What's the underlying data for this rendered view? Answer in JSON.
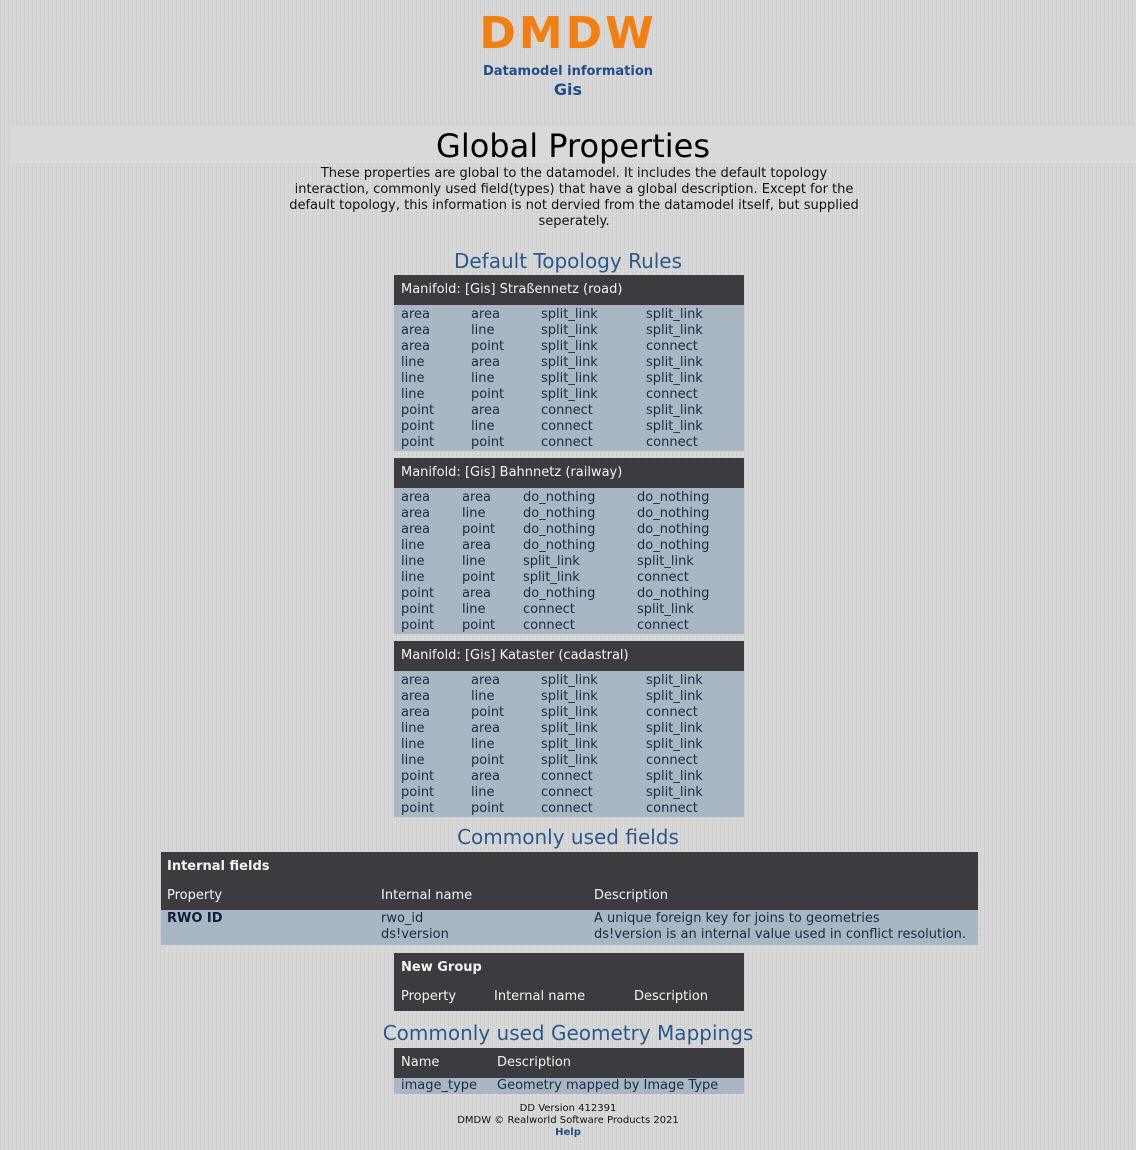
{
  "logo": "DMDW",
  "header": {
    "subtitle": "Datamodel information",
    "model": "Gis"
  },
  "page_title": "Global Properties",
  "intro": "These properties are global to the datamodel. It includes the default topology interaction, commonly used field(types) that have a global description. Except for the default topology, this information is not dervied from the datamodel itself, but supplied seperately.",
  "sections": {
    "topology": "Default Topology Rules",
    "fields": "Commonly used fields",
    "geometry": "Commonly used Geometry Mappings"
  },
  "manifolds": [
    {
      "title": "Manifold: [Gis] Straßennetz (road)",
      "rows": [
        [
          "area",
          "area",
          "split_link",
          "split_link"
        ],
        [
          "area",
          "line",
          "split_link",
          "split_link"
        ],
        [
          "area",
          "point",
          "split_link",
          "connect"
        ],
        [
          "line",
          "area",
          "split_link",
          "split_link"
        ],
        [
          "line",
          "line",
          "split_link",
          "split_link"
        ],
        [
          "line",
          "point",
          "split_link",
          "connect"
        ],
        [
          "point",
          "area",
          "connect",
          "split_link"
        ],
        [
          "point",
          "line",
          "connect",
          "split_link"
        ],
        [
          "point",
          "point",
          "connect",
          "connect"
        ]
      ]
    },
    {
      "title": "Manifold: [Gis] Bahnnetz (railway)",
      "rows": [
        [
          "area",
          "area",
          "do_nothing",
          "do_nothing"
        ],
        [
          "area",
          "line",
          "do_nothing",
          "do_nothing"
        ],
        [
          "area",
          "point",
          "do_nothing",
          "do_nothing"
        ],
        [
          "line",
          "area",
          "do_nothing",
          "do_nothing"
        ],
        [
          "line",
          "line",
          "split_link",
          "split_link"
        ],
        [
          "line",
          "point",
          "split_link",
          "connect"
        ],
        [
          "point",
          "area",
          "do_nothing",
          "do_nothing"
        ],
        [
          "point",
          "line",
          "connect",
          "split_link"
        ],
        [
          "point",
          "point",
          "connect",
          "connect"
        ]
      ]
    },
    {
      "title": "Manifold: [Gis] Kataster (cadastral)",
      "rows": [
        [
          "area",
          "area",
          "split_link",
          "split_link"
        ],
        [
          "area",
          "line",
          "split_link",
          "split_link"
        ],
        [
          "area",
          "point",
          "split_link",
          "connect"
        ],
        [
          "line",
          "area",
          "split_link",
          "split_link"
        ],
        [
          "line",
          "line",
          "split_link",
          "split_link"
        ],
        [
          "line",
          "point",
          "split_link",
          "connect"
        ],
        [
          "point",
          "area",
          "connect",
          "split_link"
        ],
        [
          "point",
          "line",
          "connect",
          "split_link"
        ],
        [
          "point",
          "point",
          "connect",
          "connect"
        ]
      ]
    }
  ],
  "internal_fields": {
    "title": "Internal fields",
    "columns": [
      "Property",
      "Internal name",
      "Description"
    ],
    "property": "RWO ID",
    "names": [
      "rwo_id",
      "ds!version"
    ],
    "descriptions": [
      "A unique foreign key for joins to geometries",
      "ds!version is an internal value used in conflict resolution."
    ]
  },
  "new_group": {
    "title": "New Group",
    "columns": [
      "Property",
      "Internal name",
      "Description"
    ]
  },
  "geometry_mappings": {
    "columns": [
      "Name",
      "Description"
    ],
    "rows": [
      [
        "image_type",
        "Geometry mapped by Image Type"
      ]
    ]
  },
  "footer": {
    "version": "DD Version 412391",
    "copyright": "DMDW © Realworld Software Products 2021",
    "help": "Help"
  }
}
